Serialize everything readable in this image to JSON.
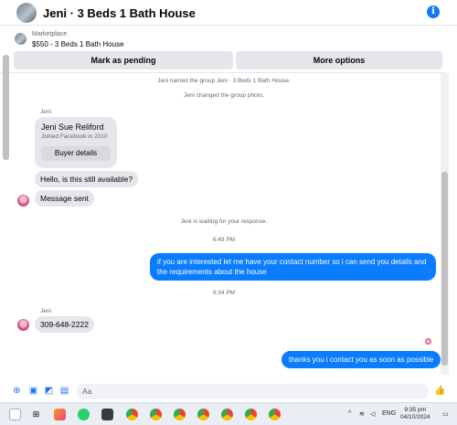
{
  "header": {
    "title": "Jeni · 3 Beds 1 Bath House",
    "info_glyph": "i"
  },
  "marketplace": {
    "label": "Marketplace",
    "listing": "$550 - 3 Beds 1 Bath House"
  },
  "actions": {
    "pending": "Mark as pending",
    "more": "More options"
  },
  "messages": {
    "sys1": "Jeni named the group Jeni · 3 Beds 1 Bath House.",
    "sys2": "Jeni changed the group photo.",
    "sender1": "Jeni",
    "card": {
      "name": "Jeni Sue Reliford",
      "sub": "Joined Facebook in 2010",
      "button": "Buyer details"
    },
    "q1": "Hello, is this still available?",
    "sent_notice": "Message sent",
    "waiting": "Jeni is waiting for your response.",
    "time1": "6:49 PM",
    "out1": "if you are interested let me have your contact number so i can send you details and the requirements about the house",
    "time2": "9:34 PM",
    "sender2": "Jeni",
    "phone": "309-648-2222",
    "out2": "thanks you i contact you as soon as possible"
  },
  "compose": {
    "placeholder": "Aa"
  },
  "taskbar": {
    "lang": "ENG",
    "time": "9:35 pm",
    "date": "04/10/2024"
  },
  "colors": {
    "accent": "#0a7cff",
    "bubble_in": "#e4e6eb",
    "brand": "#1877f2"
  }
}
